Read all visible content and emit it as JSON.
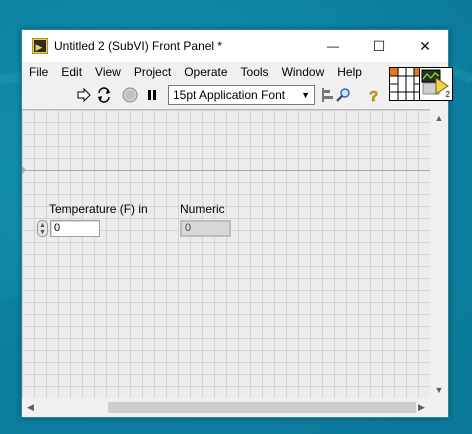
{
  "window": {
    "title": "Untitled 2 (SubVI) Front Panel *",
    "minimize_glyph": "—",
    "maximize_glyph": "☐",
    "close_glyph": "✕"
  },
  "menu": {
    "items": [
      "File",
      "Edit",
      "View",
      "Project",
      "Operate",
      "Tools",
      "Window",
      "Help"
    ]
  },
  "toolbar": {
    "run_icon": "run-arrow-icon",
    "run_continuous_icon": "run-continuously-icon",
    "abort_icon": "abort-icon",
    "pause_icon": "pause-icon",
    "font_select_value": "15pt Application Font",
    "align_icon": "align-objects-icon",
    "search_icon": "search-icon",
    "help_icon": "context-help-icon"
  },
  "panel": {
    "control": {
      "label": "Temperature (F) in",
      "value": "0"
    },
    "indicator": {
      "label": "Numeric",
      "value": "0"
    }
  },
  "vi_icon": {
    "badge": "2"
  },
  "colors": {
    "desktop": "#0e86a6",
    "panel_grid": "#d3d3d3",
    "connector_terminal_input": "#e8781c",
    "abort_red": "#c9302c"
  }
}
